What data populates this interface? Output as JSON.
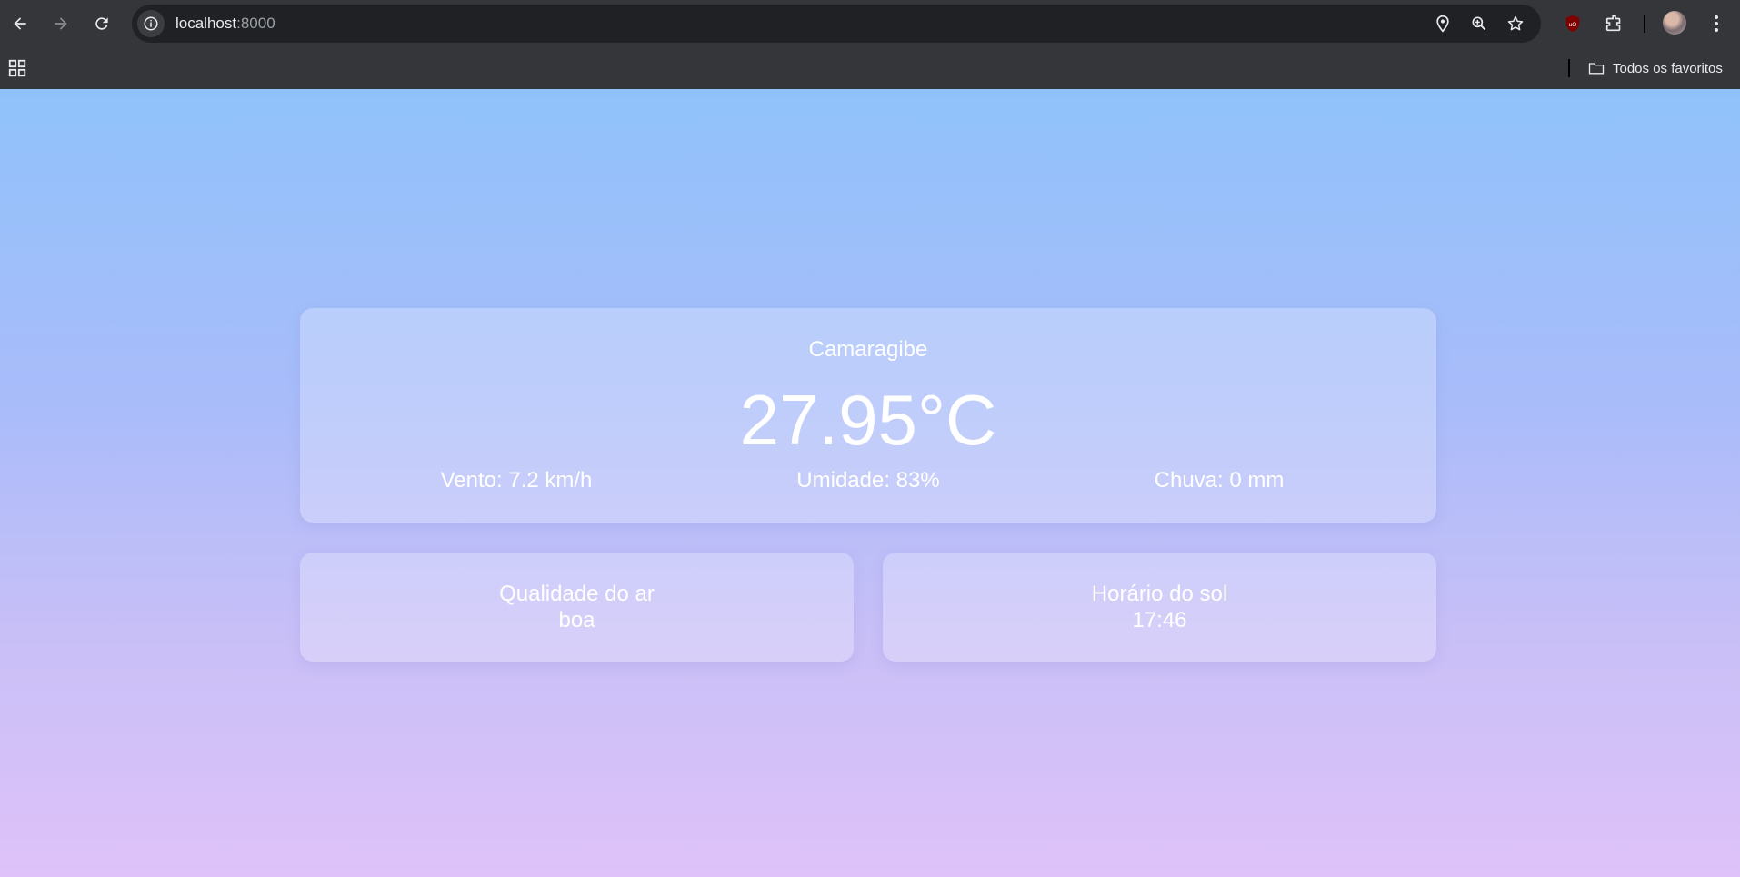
{
  "browser": {
    "url_host": "localhost",
    "url_port": ":8000",
    "bookmarks_folder": "Todos os favoritos",
    "colors": {
      "toolbar": "#35363a",
      "omnibox": "#202124",
      "text": "#e8eaed"
    },
    "icons": [
      "back-icon",
      "forward-icon",
      "reload-icon",
      "site-info-icon",
      "location-icon",
      "zoom-icon",
      "star-icon",
      "ublock-icon",
      "extensions-icon",
      "avatar",
      "menu-icon",
      "apps-icon",
      "folder-icon"
    ]
  },
  "weather": {
    "city": "Camaragibe",
    "temperature": "27.95°C",
    "wind": "Vento: 7.2 km/h",
    "humidity": "Umidade: 83%",
    "rain": "Chuva: 0 mm"
  },
  "air_quality": {
    "label": "Qualidade do ar",
    "value": "boa"
  },
  "sun": {
    "label": "Horário do sol",
    "value": "17:46"
  },
  "colors": {
    "gradient_top": "#90c2fa",
    "gradient_bottom": "#dec2f9",
    "card_text": "#ffffff"
  }
}
